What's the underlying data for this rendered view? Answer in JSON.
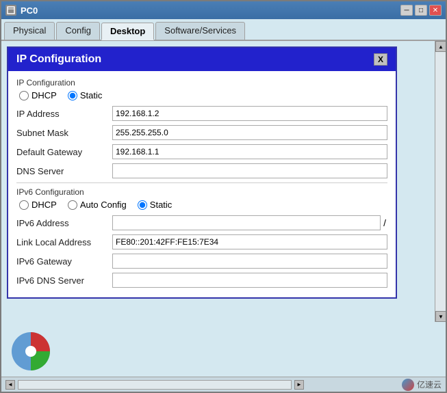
{
  "window": {
    "title": "PC0",
    "minimize_label": "─",
    "maximize_label": "□",
    "close_label": "✕"
  },
  "tabs": [
    {
      "id": "physical",
      "label": "Physical",
      "active": false
    },
    {
      "id": "config",
      "label": "Config",
      "active": false
    },
    {
      "id": "desktop",
      "label": "Desktop",
      "active": true
    },
    {
      "id": "software-services",
      "label": "Software/Services",
      "active": false
    }
  ],
  "ip_config": {
    "header": "IP Configuration",
    "close_label": "X",
    "section_ipv4": "IP Configuration",
    "dhcp_label": "DHCP",
    "static_label": "Static",
    "ip_address_label": "IP Address",
    "ip_address_value": "192.168.1.2",
    "subnet_mask_label": "Subnet Mask",
    "subnet_mask_value": "255.255.255.0",
    "default_gateway_label": "Default Gateway",
    "default_gateway_value": "192.168.1.1",
    "dns_server_label": "DNS Server",
    "dns_server_value": "",
    "section_ipv6": "IPv6 Configuration",
    "dhcp6_label": "DHCP",
    "auto_config_label": "Auto Config",
    "static6_label": "Static",
    "ipv6_address_label": "IPv6 Address",
    "ipv6_address_value": "",
    "ipv6_slash": "/",
    "link_local_label": "Link Local Address",
    "link_local_value": "FE80::201:42FF:FE15:7E34",
    "ipv6_gateway_label": "IPv6 Gateway",
    "ipv6_gateway_value": "",
    "ipv6_dns_label": "IPv6 DNS Server",
    "ipv6_dns_value": ""
  },
  "status_bar": {
    "watermark": "亿速云"
  }
}
